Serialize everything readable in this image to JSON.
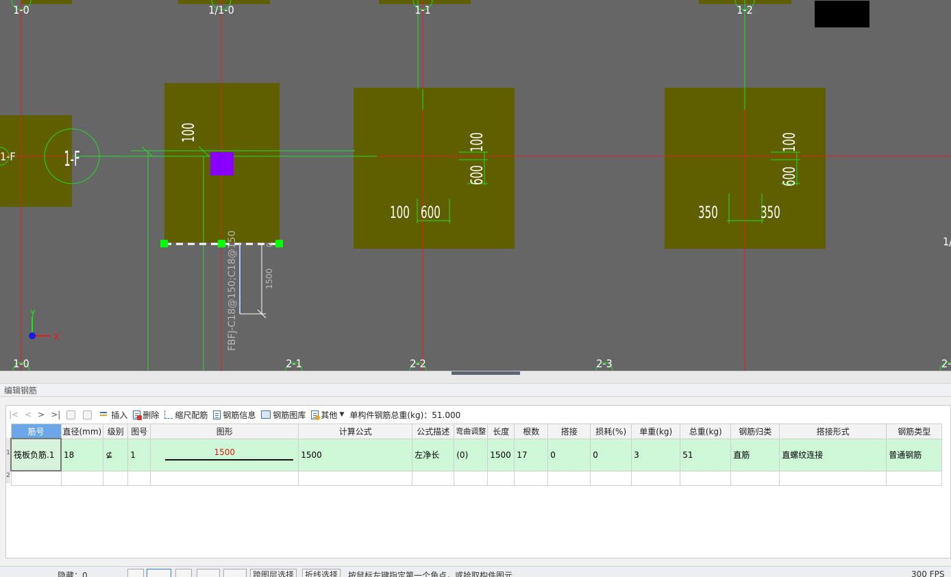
{
  "canvas": {
    "axis_labels_top": [
      "1-0",
      "1/1-0",
      "1-1",
      "1-2"
    ],
    "axis_labels_bottom": [
      "1-0",
      "2-1",
      "2-2",
      "2-3",
      "2-"
    ],
    "axis_label_left": "1-F",
    "axis_bubble_label": "1-F",
    "right_edge_label": "1/",
    "dims_col1": {
      "vertical": "100"
    },
    "dims_col2": {
      "top": "100",
      "mid": "600",
      "left": "100",
      "right": "600"
    },
    "dims_col3": {
      "top": "100",
      "mid": "600",
      "left": "350",
      "right": "350"
    },
    "rebar_label": "FBFJ-C18@150;C18@150",
    "rebar_length": "1500",
    "rebar_small": "0",
    "ucs_x": "X",
    "ucs_y": "Y",
    "colors": {
      "background": "#666666",
      "column": "#5f5f00",
      "grid_red": "#e02020",
      "line_green": "#22dd22",
      "selection_purple": "#8a00ff"
    }
  },
  "panel": {
    "title": "编辑钢筋",
    "toolbar": {
      "nav": [
        "|<",
        "<",
        ">",
        ">|"
      ],
      "insert": "插入",
      "delete": "删除",
      "scale_rebar": "缩尺配筋",
      "rebar_info": "钢筋信息",
      "rebar_library": "钢筋图库",
      "other": "其他",
      "total_weight": "单构件钢筋总重(kg)：51.000"
    },
    "table": {
      "headers": [
        "筋号",
        "直径(mm)",
        "级别",
        "图号",
        "图形",
        "计算公式",
        "公式描述",
        "弯曲调整",
        "长度",
        "根数",
        "搭接",
        "损耗(%)",
        "单重(kg)",
        "总重(kg)",
        "钢筋归类",
        "搭接形式",
        "钢筋类型"
      ],
      "row_numbers": [
        "1",
        "2"
      ],
      "rows": [
        {
          "name": "筏板负筋.1",
          "diameter": "18",
          "grade": "⊈",
          "figure_no": "1",
          "shape_value": "1500",
          "formula": "1500",
          "formula_desc": "左净长",
          "bend_adjust": "(0)",
          "length": "1500",
          "count": "17",
          "lap": "0",
          "loss": "0",
          "unit_weight": "3",
          "total_weight": "51",
          "category": "直筋",
          "lap_type": "直螺纹连接",
          "rebar_type": "普通钢筋"
        }
      ]
    }
  },
  "status": {
    "hide_label": "隐藏：0",
    "cross_layer": "跨图层选择",
    "fold_select": "折线选择",
    "hint": "按鼠标左键指定第一个角点，或拾取构件图元",
    "fps": "300 FPS"
  }
}
